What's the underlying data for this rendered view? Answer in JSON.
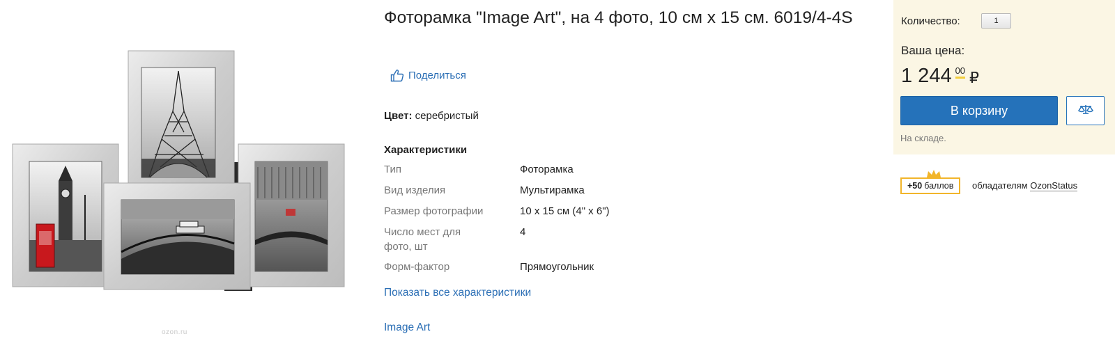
{
  "image": {
    "watermark": "ozon.ru"
  },
  "title": "Фоторамка \"Image Art\", на 4 фото, 10 см х 15 см. 6019/4-4S",
  "share": {
    "label": "Поделиться",
    "icon": "thumbs-up-icon"
  },
  "color": {
    "label": "Цвет:",
    "value": "серебристый"
  },
  "specs": {
    "heading": "Характеристики",
    "rows": [
      {
        "label": "Тип",
        "value": "Фоторамка"
      },
      {
        "label": "Вид изделия",
        "value": "Мультирамка"
      },
      {
        "label": "Размер фотографии",
        "value": "10 х 15 см (4\" х 6\")"
      },
      {
        "label": "Число мест для фото, шт",
        "value": "4"
      },
      {
        "label": "Форм-фактор",
        "value": "Прямоугольник"
      }
    ],
    "show_all": "Показать все характеристики"
  },
  "brand": "Image Art",
  "buy_box": {
    "quantity_label": "Количество:",
    "quantity_value": "1",
    "price_label": "Ваша цена:",
    "price_main": "1 244",
    "price_kopecks": "00",
    "currency": "₽",
    "cart_button": "В корзину",
    "compare_icon": "scales-icon",
    "stock": "На складе."
  },
  "points": {
    "amount": "+50",
    "unit": "баллов",
    "text": "обладателям",
    "link": "OzonStatus"
  },
  "colors": {
    "link": "#2a6eb5",
    "cart_button": "#2572ba",
    "buy_box_bg": "#fbf6e4",
    "points_border": "#f2b52a"
  }
}
